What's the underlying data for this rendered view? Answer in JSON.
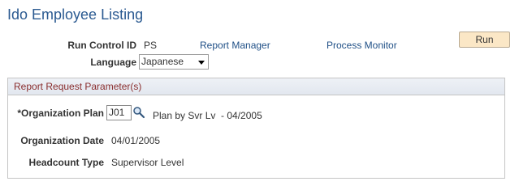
{
  "page": {
    "title": "Ido Employee Listing"
  },
  "run_control": {
    "label": "Run Control ID",
    "value": "PS"
  },
  "links": {
    "report_manager": "Report Manager",
    "process_monitor": "Process Monitor"
  },
  "run_button": {
    "label": "Run"
  },
  "language": {
    "label": "Language",
    "selected": "Japanese"
  },
  "parameters": {
    "group_title": "Report Request Parameter(s)",
    "org_plan": {
      "label": "*Organization Plan",
      "value": "J01",
      "description": "Plan by Svr Lv  - 04/2005"
    },
    "org_date": {
      "label": "Organization Date",
      "value": "04/01/2005"
    },
    "headcount_type": {
      "label": "Headcount Type",
      "value": "Supervisor Level"
    }
  },
  "colors": {
    "title": "#2b5a91",
    "link": "#1f4f86",
    "group_title": "#8a2e2e",
    "run_button_bg": "#fbe7c6"
  },
  "icons": {
    "lookup": "magnifier-icon",
    "dropdown": "chevron-down-icon"
  }
}
